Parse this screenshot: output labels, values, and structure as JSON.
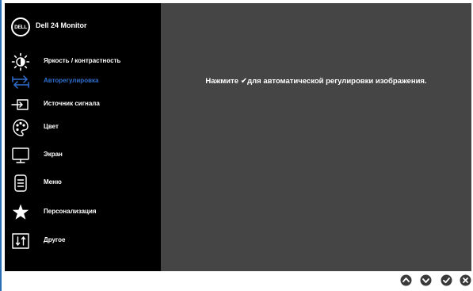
{
  "osd": {
    "brand_logo_text": "DELL",
    "monitor_name": "Dell 24 Monitor",
    "menu_items": [
      {
        "label": "Яркость / контрастность",
        "icon": "brightness-icon"
      },
      {
        "label": "Авторегулировка",
        "icon": "auto-adjust-icon",
        "selected": true
      },
      {
        "label": "Источник сигнала",
        "icon": "input-source-icon"
      },
      {
        "label": "Цвет",
        "icon": "color-palette-icon"
      },
      {
        "label": "Экран",
        "icon": "display-monitor-icon"
      },
      {
        "label": "Меню",
        "icon": "menu-icon"
      },
      {
        "label": "Персонализация",
        "icon": "star-icon"
      },
      {
        "label": "Другое",
        "icon": "other-settings-icon"
      }
    ],
    "message": {
      "before": "Нажмите",
      "after": "для автоматической регулировки изображения."
    }
  },
  "buttons": [
    {
      "name": "up",
      "icon": "up-arrow-icon"
    },
    {
      "name": "down",
      "icon": "down-arrow-icon"
    },
    {
      "name": "ok",
      "icon": "check-icon"
    },
    {
      "name": "exit",
      "icon": "close-icon"
    }
  ],
  "colors": {
    "sidebar": "#000000",
    "panel": "#454545",
    "accent": "#2f6fd0",
    "text": "#ffffff",
    "button": "#3a3a3a"
  }
}
